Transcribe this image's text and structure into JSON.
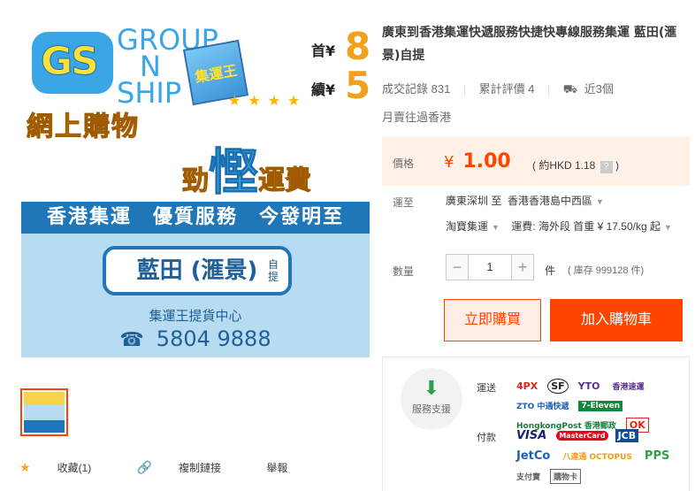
{
  "image": {
    "logo_gs": "GS",
    "logo_lines": [
      "GROUP",
      "N",
      "SHIP"
    ],
    "bag_text": "集運王",
    "first_label": "首¥",
    "first_value": "8",
    "next_label": "續¥",
    "next_value": "5",
    "slogan_a": "網上購物",
    "slogan_b_pre": "勁",
    "slogan_b_big": "慳",
    "slogan_b_post": "運費",
    "banner_top": "香港集運　優質服務　今發明至",
    "banner_location": "藍田 (滙景)",
    "banner_self": "自提",
    "banner_center": "集運王提貨中心",
    "banner_phone": "5804 9888"
  },
  "actions": {
    "favorite": "收藏(1)",
    "copy_link": "複制鏈接",
    "report": "舉報"
  },
  "product": {
    "title": "廣東到香港集運快遞服務快捷快專線服務集運 藍田(滙景)自提",
    "records_label": "成交記錄",
    "records_value": "831",
    "reviews_label": "累計評價",
    "reviews_value": "4",
    "delivery": "近3個",
    "monthly": "月賣往過香港",
    "price_label": "價格",
    "price_currency": "¥",
    "price_value": "1.00",
    "price_hkd": "( 約HKD 1.18",
    "price_hkd_close": ")",
    "ship_label": "運至",
    "ship_from": "廣東深圳 至",
    "ship_to": "香港香港島中西區",
    "ship_method": "淘寶集運",
    "ship_fee": "運費: 海外段 首重 ¥ 17.50/kg 起",
    "qty_label": "數量",
    "qty_value": "1",
    "qty_unit": "件",
    "stock": "( 庫存 999128 件)",
    "buy_now": "立即購買",
    "add_cart": "加入購物車"
  },
  "service": {
    "support": "服務支援",
    "shipping_label": "運送",
    "payment_label": "付款",
    "shipping_logos": [
      "4PX",
      "SF",
      "YTO",
      "香港速運",
      "ZTO 中通快遞",
      "7-Eleven",
      "HongkongPost 香港郵政",
      "OK"
    ],
    "payment_logos": [
      "VISA",
      "MasterCard",
      "JCB",
      "JetCo",
      "八達通 OCTOPUS",
      "PPS",
      "支付寶",
      "購物卡"
    ]
  },
  "colors": {
    "accent": "#ff4400",
    "price_bg": "#fff1e8",
    "banner_blue": "#1f76b8",
    "logo_blue": "#3aa6e6",
    "gold": "#f5a623"
  }
}
